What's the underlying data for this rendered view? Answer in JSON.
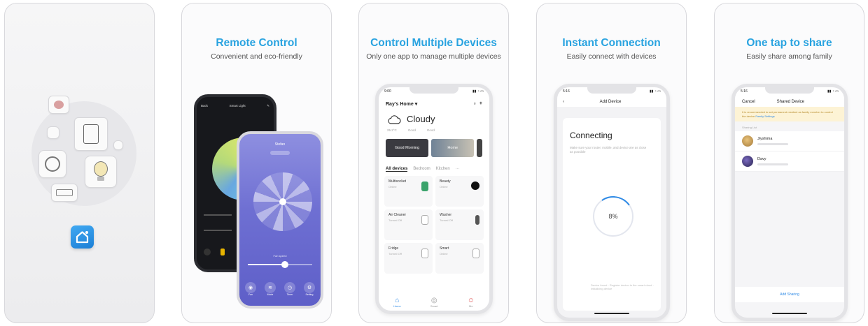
{
  "cards": [
    {},
    {
      "title": "Remote Control",
      "subtitle": "Convenient and eco-friendly",
      "dark_phone": {
        "header": "Smart Light",
        "back": "Back"
      },
      "purple_phone": {
        "header": "Stefan",
        "slider_label": "Fan speed"
      },
      "controls": [
        "Fan",
        "Mode",
        "Timer",
        "Setting"
      ]
    },
    {
      "title": "Control Multiple Devices",
      "subtitle": "Only one app to manage multiple devices",
      "home": "Ray's Home ▾",
      "weather": "Cloudy",
      "weather_stats": [
        "25.2°C",
        "Good",
        "Good"
      ],
      "scenes": [
        "Good Morning",
        "Home"
      ],
      "tabs": [
        "All devices",
        "Bedroom",
        "Kitchen"
      ],
      "devices": [
        {
          "name": "Multisocket",
          "state": "Online"
        },
        {
          "name": "Beauty",
          "state": "Online"
        },
        {
          "name": "Air Cleaner",
          "state": "Turned Off"
        },
        {
          "name": "Washer",
          "state": "Turned Off"
        },
        {
          "name": "Fridge",
          "state": "Turned Off"
        },
        {
          "name": "Smart",
          "state": "Online"
        }
      ],
      "nav": [
        "Home",
        "Smart",
        "Me"
      ]
    },
    {
      "title": "Instant Connection",
      "subtitle": "Easily connect with devices",
      "topbar_title": "Add Device",
      "connecting": "Connecting",
      "connecting_hint": "Make sure your router, mobile, and device are as close as possible",
      "progress": "8%",
      "progress_value": 0.08,
      "footer": "Device found · Register device to the smart cloud · Initializing device"
    },
    {
      "title": "One tap to share",
      "subtitle": "Easily share among family",
      "cancel": "Cancel",
      "topbar_title": "Shared Device",
      "warning": "It is recommended to set permanent resident as family member to control the device",
      "warning_link": "Family Settings",
      "sharing_label": "Sharing List",
      "members": [
        "Jiyshima",
        "Davy"
      ],
      "add_sharing": "Add Sharing"
    }
  ],
  "accent": "#29a3e0"
}
